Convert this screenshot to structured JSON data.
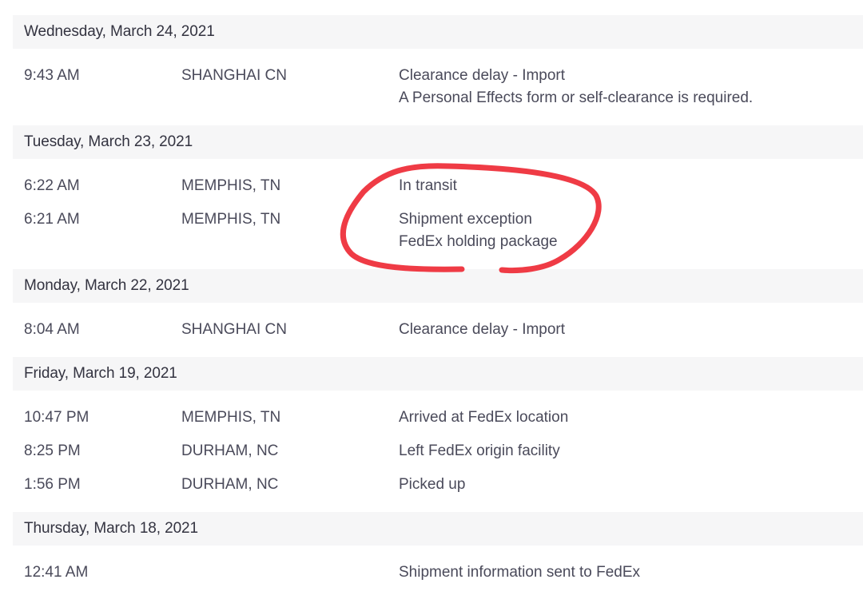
{
  "tracking_history": [
    {
      "date": "Wednesday, March 24, 2021",
      "events": [
        {
          "time": "9:43 AM",
          "location": "SHANGHAI CN",
          "status": "Clearance delay - Import",
          "detail": "A Personal Effects form or self-clearance is required."
        }
      ]
    },
    {
      "date": "Tuesday, March 23, 2021",
      "events": [
        {
          "time": "6:22 AM",
          "location": "MEMPHIS, TN",
          "status": "In transit",
          "detail": ""
        },
        {
          "time": "6:21 AM",
          "location": "MEMPHIS, TN",
          "status": "Shipment exception",
          "detail": "FedEx holding package"
        }
      ]
    },
    {
      "date": "Monday, March 22, 2021",
      "events": [
        {
          "time": "8:04 AM",
          "location": "SHANGHAI CN",
          "status": "Clearance delay - Import",
          "detail": ""
        }
      ]
    },
    {
      "date": "Friday, March 19, 2021",
      "events": [
        {
          "time": "10:47 PM",
          "location": "MEMPHIS, TN",
          "status": "Arrived at FedEx location",
          "detail": ""
        },
        {
          "time": "8:25 PM",
          "location": "DURHAM, NC",
          "status": "Left FedEx origin facility",
          "detail": ""
        },
        {
          "time": "1:56 PM",
          "location": "DURHAM, NC",
          "status": "Picked up",
          "detail": ""
        }
      ]
    },
    {
      "date": "Thursday, March 18, 2021",
      "events": [
        {
          "time": "12:41 AM",
          "location": "",
          "status": "Shipment information sent to FedEx",
          "detail": ""
        }
      ]
    }
  ],
  "annotation": {
    "type": "hand-drawn-circle",
    "color": "#ef3b45",
    "target": "Tuesday, March 23, 2021 events"
  }
}
